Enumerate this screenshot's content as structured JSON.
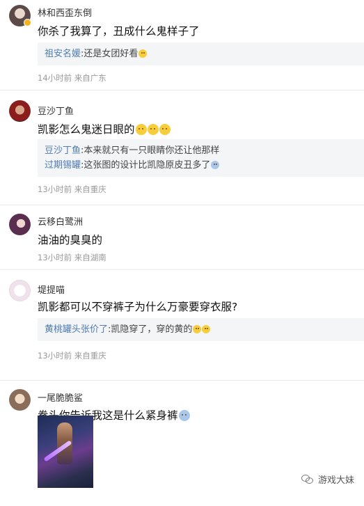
{
  "comments": [
    {
      "username": "林和西歪东倒",
      "text": "你杀了我算了，丑成什么鬼样子了",
      "replies": [
        {
          "name": "祖安名媛",
          "sep": ":",
          "text": "还是女团好看"
        }
      ],
      "meta": "14小时前 来自广东"
    },
    {
      "username": "豆沙丁鱼",
      "text": "凯影怎么鬼迷日眼的",
      "replies": [
        {
          "name": "豆沙丁鱼",
          "sep": ":",
          "text": "本来就只有一只眼睛你还让他那样"
        },
        {
          "name": "过期锡罐",
          "sep": ":",
          "text": "这张图的设计比凯隐原皮丑多了"
        }
      ],
      "meta": "13小时前 来自重庆"
    },
    {
      "username": "云移白鹭洲",
      "text": "油油的臭臭的",
      "meta": "13小时前 来自湖南"
    },
    {
      "username": "堤提喵",
      "text": "凯影都可以不穿裤子为什么万豪要穿衣服?",
      "replies": [
        {
          "name": "黄桃罐头张价了",
          "sep": ":",
          "text": "凯隐穿了，穿的黄的"
        }
      ],
      "meta": "13小时前 来自重庆"
    },
    {
      "username": "一尾脆脆鲨",
      "text": "拳头你告诉我这是什么紧身裤"
    }
  ],
  "watermark": {
    "icon": "wechat-icon",
    "text": "游戏大妹"
  },
  "colors": {
    "reply_name": "#4f7cb3",
    "meta": "#9a9a9a",
    "quote_bg": "#f4f5f7"
  }
}
